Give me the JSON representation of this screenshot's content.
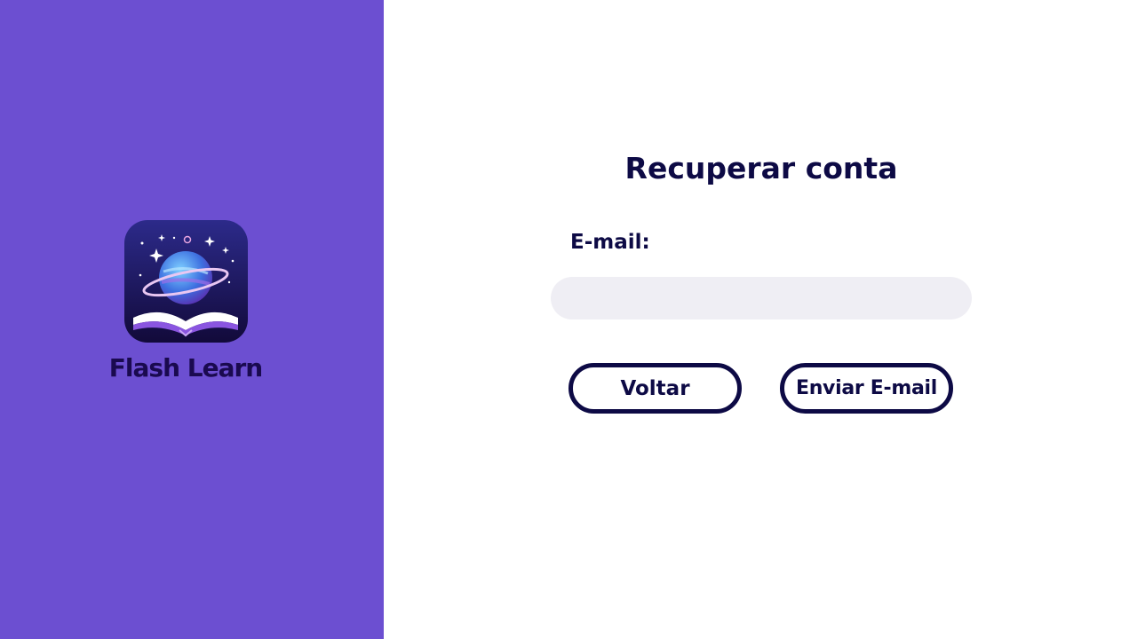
{
  "brand": {
    "name": "Flash Learn",
    "icon": "flash-learn-logo-icon",
    "panel_color": "#6c4fd1"
  },
  "form": {
    "title": "Recuperar conta",
    "email_label": "E-mail:",
    "email_value": "",
    "email_placeholder": ""
  },
  "buttons": {
    "back_label": "Voltar",
    "send_label": "Enviar E-mail"
  },
  "colors": {
    "text_dark": "#0d0a45",
    "input_bg": "#efeef4",
    "accent": "#6c4fd1"
  }
}
